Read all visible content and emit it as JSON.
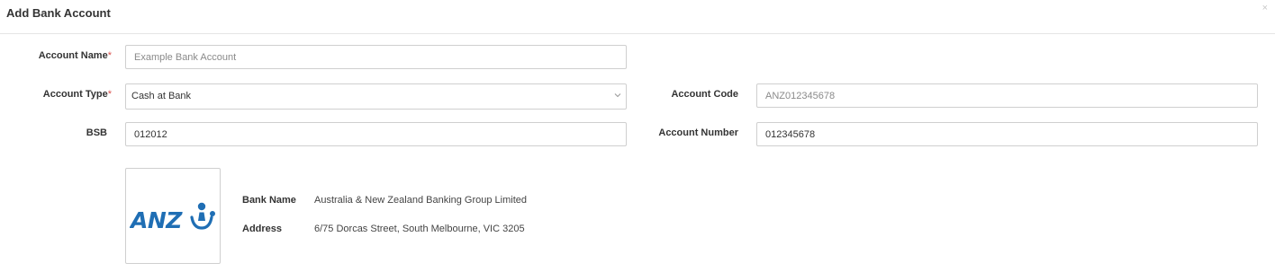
{
  "dialog": {
    "title": "Add Bank Account",
    "close_symbol": "×"
  },
  "form": {
    "account_name": {
      "label": "Account Name",
      "required": "*",
      "value": "",
      "placeholder": "Example Bank Account"
    },
    "account_type": {
      "label": "Account Type",
      "required": "*",
      "value": "Cash at Bank"
    },
    "account_code": {
      "label": "Account Code",
      "value": "",
      "placeholder": "ANZ012345678"
    },
    "bsb": {
      "label": "BSB",
      "value": "012012"
    },
    "account_number": {
      "label": "Account Number",
      "value": "012345678"
    }
  },
  "bank": {
    "logo_text": "ANZ",
    "logo_color": "#1f6eb4",
    "name_label": "Bank Name",
    "name_value": "Australia & New Zealand Banking Group Limited",
    "address_label": "Address",
    "address_value": "6/75 Dorcas Street, South Melbourne, VIC 3205"
  },
  "icons": {
    "close": "close-icon",
    "dropdown": "chevron-down-icon",
    "logo": "anz-logo"
  }
}
